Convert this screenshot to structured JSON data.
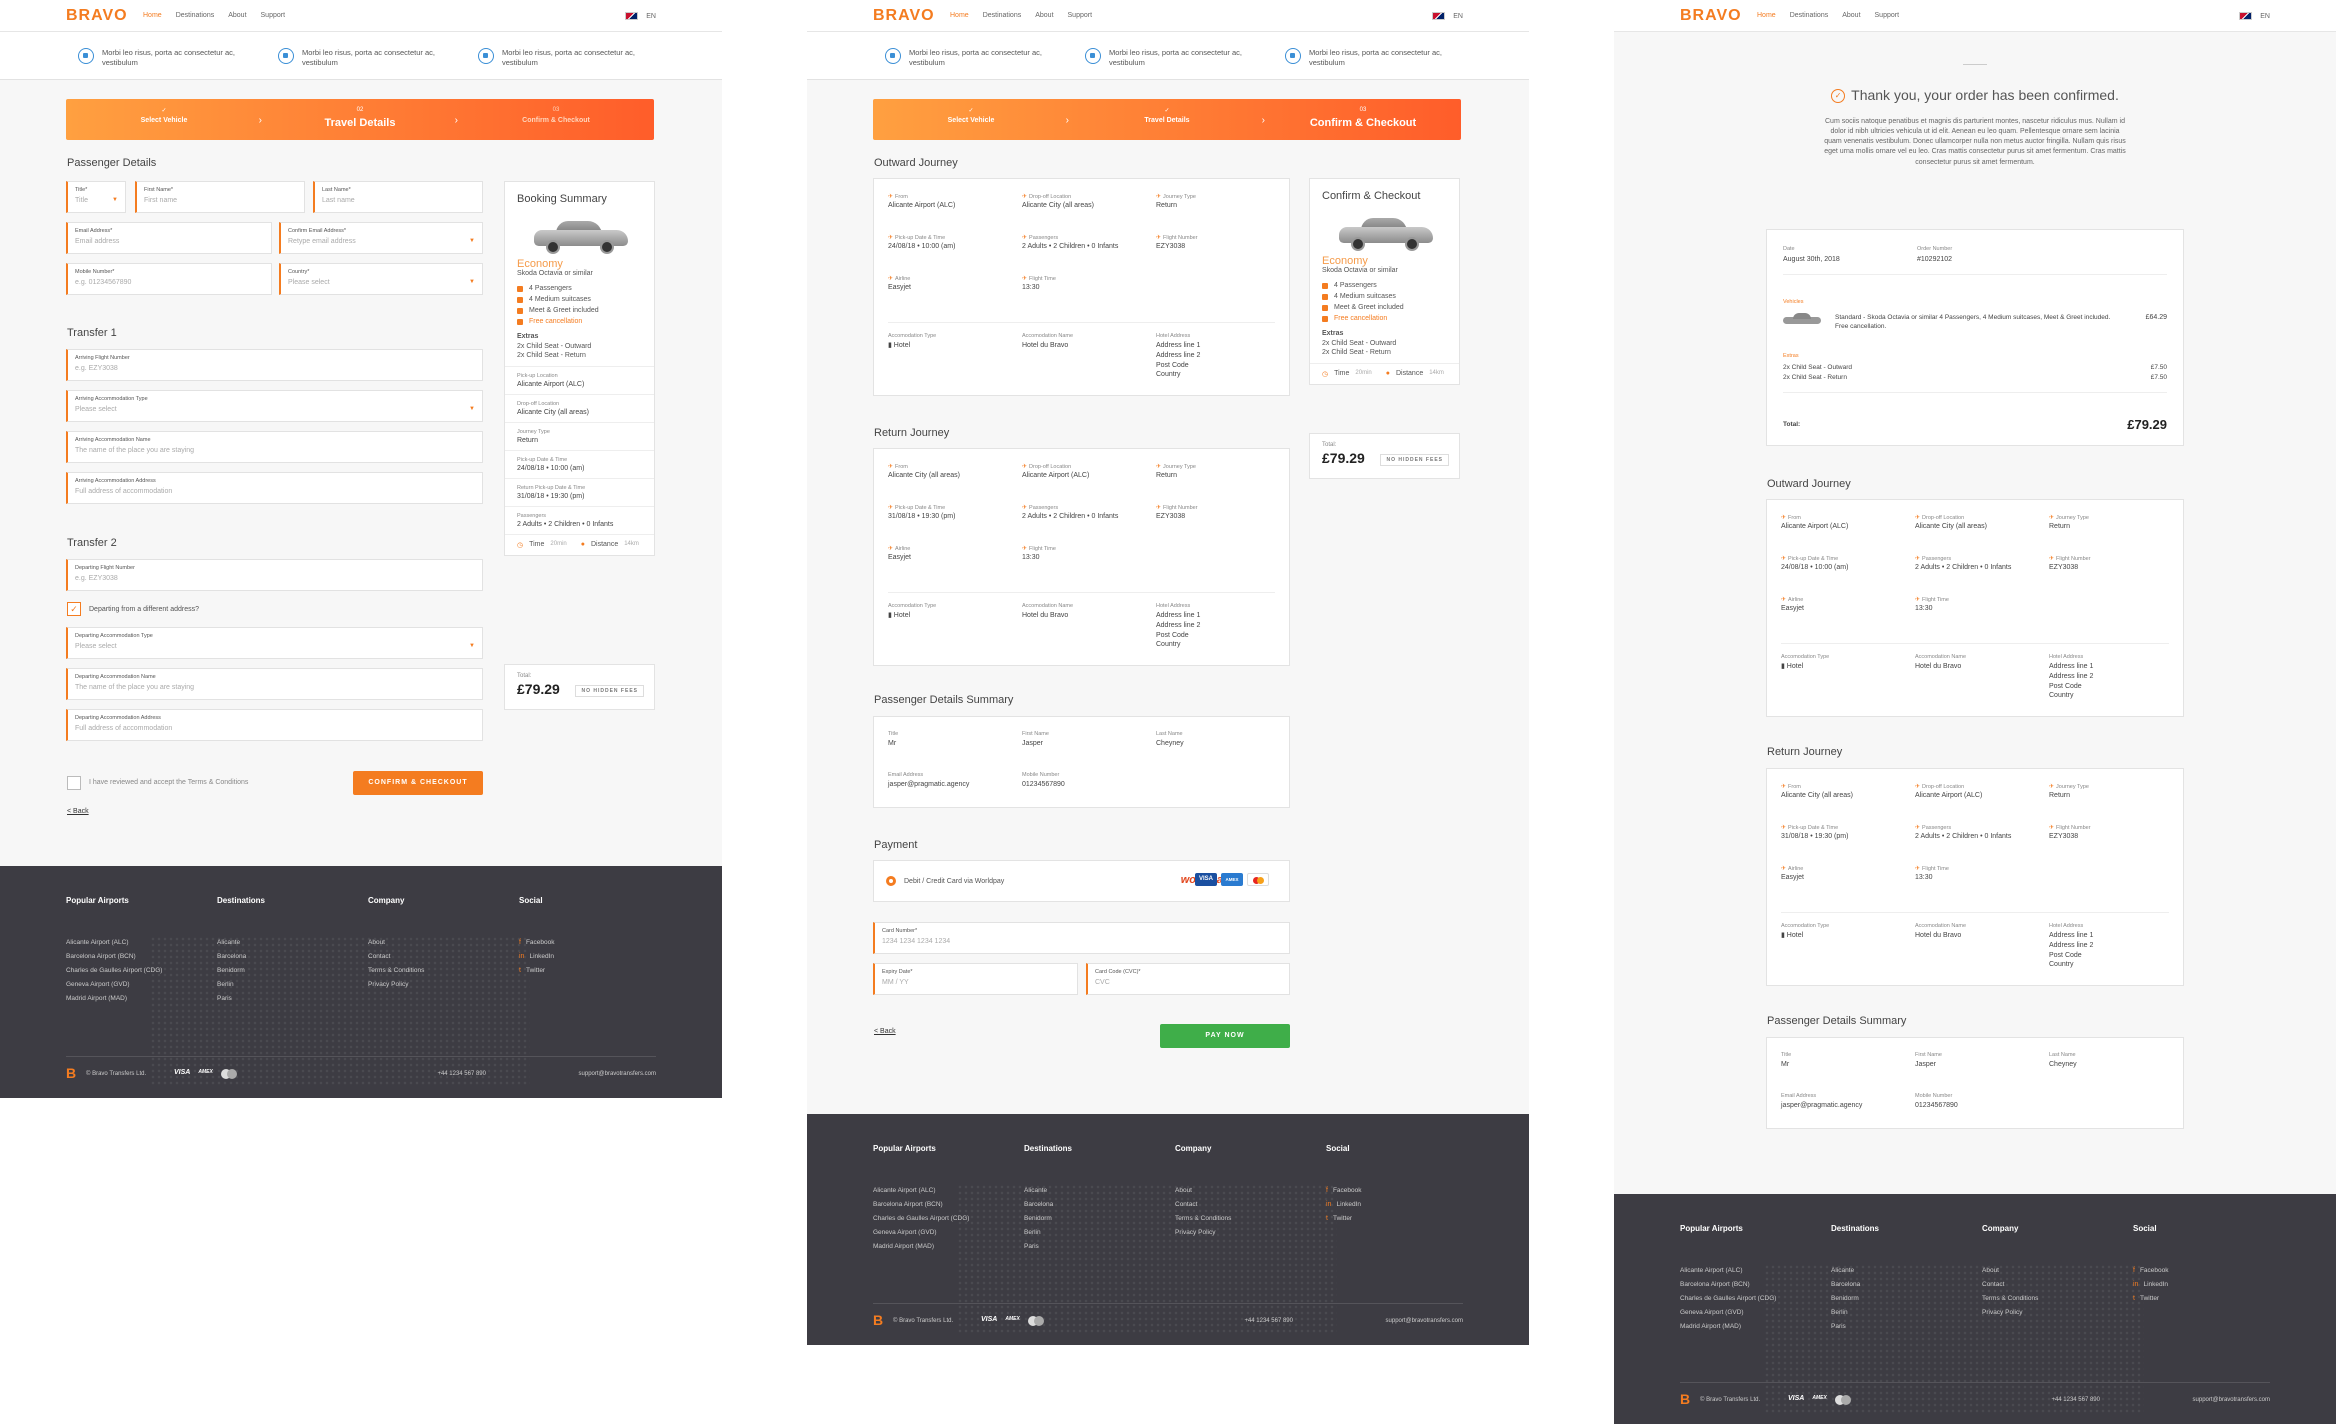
{
  "nav": {
    "logo": "BRAVO",
    "links": [
      "Home",
      "Destinations",
      "About",
      "Support"
    ],
    "lang": "EN"
  },
  "features": [
    "Morbi leo risus, porta ac consectetur ac, vestibulum",
    "Morbi leo risus, porta ac consectetur ac, vestibulum",
    "Morbi leo risus, porta ac consectetur ac, vestibulum"
  ],
  "steps": [
    {
      "n": "",
      "label": "Select Vehicle"
    },
    {
      "n": "02",
      "label": "Travel Details"
    },
    {
      "n": "03",
      "label": "Confirm & Checkout"
    }
  ],
  "steps2": [
    {
      "label": "Select Vehicle"
    },
    {
      "label": "Travel Details"
    },
    {
      "label": "Confirm & Checkout"
    }
  ],
  "check": "✓",
  "p1": {
    "passenger_title": "Passenger Details",
    "title": {
      "label": "Title*",
      "ph": "Title"
    },
    "first": {
      "label": "First Name*",
      "ph": "First name"
    },
    "last": {
      "label": "Last Name*",
      "ph": "Last name"
    },
    "email": {
      "label": "Email Address*",
      "ph": "Email address"
    },
    "email2": {
      "label": "Confirm Email Address*",
      "ph": "Retype email address"
    },
    "mobile": {
      "label": "Mobile Number*",
      "ph": "e.g. 01234567890"
    },
    "country": {
      "label": "Country*",
      "ph": "Please select"
    },
    "transfer1": "Transfer 1",
    "t1": [
      {
        "label": "Arriving Flight Number",
        "ph": "e.g. EZY3038"
      },
      {
        "label": "Arriving Accommodation Type",
        "ph": "Please select"
      },
      {
        "label": "Arriving Accommodation Name",
        "ph": "The name of the place you are staying"
      },
      {
        "label": "Arriving Accommodation Address",
        "ph": "Full address of accommodation"
      }
    ],
    "transfer2": "Transfer 2",
    "t2flight": {
      "label": "Departing Flight Number",
      "ph": "e.g. EZY3038"
    },
    "diff": "Departing from a different address?",
    "t2": [
      {
        "label": "Departing Accommodation Type",
        "ph": "Please select"
      },
      {
        "label": "Departing Accommodation Name",
        "ph": "The name of the place you are staying"
      },
      {
        "label": "Departing Accommodation Address",
        "ph": "Full address of accommodation"
      }
    ],
    "terms": "I have reviewed and accept the Terms & Conditions",
    "confirm_btn": "CONFIRM & CHECKOUT",
    "back": "< Back"
  },
  "summary": {
    "title1": "Booking Summary",
    "title2": "Confirm & Checkout",
    "class": "Economy",
    "car": "Skoda Octavia or similar",
    "features": [
      "4 Passengers",
      "4 Medium suitcases",
      "Meet & Greet included",
      "Free cancellation"
    ],
    "extras_label": "Extras",
    "extras": [
      "2x Child Seat - Outward",
      "2x Child Seat - Return"
    ],
    "details": [
      {
        "k": "Pick-up Location",
        "v": "Alicante Airport (ALC)"
      },
      {
        "k": "Drop-off Location",
        "v": "Alicante City (all areas)"
      },
      {
        "k": "Journey Type",
        "v": "Return"
      },
      {
        "k": "Pick-up Date & Time",
        "v": "24/08/18 • 10:00 (am)"
      },
      {
        "k": "Return Pick-up Date & Time",
        "v": "31/08/18 • 19:30 (pm)"
      },
      {
        "k": "Passengers",
        "v": "2 Adults • 2 Children • 0 Infants"
      }
    ],
    "time_label": "Time",
    "time": "20min",
    "dist_label": "Distance",
    "dist": "14km",
    "total_label": "Total:",
    "total": "£79.29",
    "nohidden": "NO HIDDEN FEES"
  },
  "outward": {
    "title": "Outward Journey",
    "from": "Alicante Airport (ALC)",
    "to": "Alicante City (all areas)",
    "type": "Return",
    "date": "24/08/18 • 10:00 (am)",
    "pax": "2 Adults • 2 Children • 0 Infants",
    "flight": "EZY3038",
    "airline": "Easyjet",
    "ftime": "13:30"
  },
  "return": {
    "title": "Return Journey",
    "from": "Alicante City (all areas)",
    "to": "Alicante Airport (ALC)",
    "type": "Return",
    "date": "31/08/18 • 19:30 (pm)",
    "pax": "2 Adults • 2 Children • 0 Infants",
    "flight": "EZY3038",
    "airline": "Easyjet",
    "ftime": "13:30"
  },
  "jlabels": {
    "from": "From",
    "to": "Drop-off Location",
    "type": "Journey Type",
    "date": "Pick-up Date & Time",
    "pax": "Passengers",
    "flight": "Flight Number",
    "airline": "Airline",
    "ftime": "Flight Time",
    "acc_type": "Accomodation Type",
    "acc_name": "Accomodation Name",
    "hotel_addr": "Hotel Address"
  },
  "accom": {
    "type": "Hotel",
    "name": "Hotel du Bravo",
    "addr": "Address line 1\nAddress line 2\nPost Code\nCountry"
  },
  "pax_summary": {
    "title": "Passenger Details Summary",
    "title_k": "Title",
    "title_v": "Mr",
    "first_k": "First Name",
    "first_v": "Jasper",
    "last_k": "Last Name",
    "last_v": "Cheyney",
    "email_k": "Email Address",
    "email_v": "jasper@pragmatic.agency",
    "mobile_k": "Mobile Number",
    "mobile_v": "01234567890"
  },
  "payment": {
    "title": "Payment",
    "method": "Debit / Credit Card via Worldpay",
    "worldpay": "worldpay",
    "visa": "VISA",
    "amex": "AMEX",
    "card": {
      "label": "Card Number*",
      "ph": "1234 1234 1234 1234"
    },
    "expiry": {
      "label": "Expiry Date*",
      "ph": "MM / YY"
    },
    "cvc": {
      "label": "Card Code (CVC)*",
      "ph": "CVC"
    },
    "back": "< Back",
    "pay_btn": "PAY NOW"
  },
  "confirmation": {
    "title": "Thank you, your order has been confirmed.",
    "text": "Cum sociis natoque penatibus et magnis dis parturient montes, nascetur ridiculus mus. Nullam id dolor id nibh ultricies vehicula ut id elit. Aenean eu leo quam. Pellentesque ornare sem lacinia quam venenatis vestibulum. Donec ullamcorper nulla non metus auctor fringilla. Nullam quis risus eget urna mollis ornare vel eu leo. Cras mattis consectetur purus sit amet fermentum. Cras mattis consectetur purus sit amet fermentum.",
    "date_k": "Date",
    "date_v": "August 30th, 2018",
    "order_k": "Order Number",
    "order_v": "#10292102",
    "vehicles": "Vehicles",
    "vehicle_desc": "Standard - Skoda Octavia or similar 4 Passengers, 4 Medium suitcases, Meet & Greet included. Free cancellation.",
    "vehicle_price": "£64.29",
    "extras": "Extras",
    "extra1": "2x Child Seat - Outward",
    "extra1_p": "£7.50",
    "extra2": "2x Child Seat - Return",
    "extra2_p": "£7.50",
    "total_k": "Total:",
    "total_v": "£79.29"
  },
  "footer": {
    "cols": [
      {
        "h": "Popular Airports",
        "items": [
          "Alicante Airport (ALC)",
          "Barcelona Airport (BCN)",
          "Charles de Gaulles Airport (CDG)",
          "Geneva Airport (GVD)",
          "Madrid Airport (MAD)"
        ]
      },
      {
        "h": "Destinations",
        "items": [
          "Alicante",
          "Barcelona",
          "Benidorm",
          "Berlin",
          "Paris"
        ]
      },
      {
        "h": "Company",
        "items": [
          "About",
          "Contact",
          "Terms & Conditions",
          "Privacy Policy"
        ]
      },
      {
        "h": "Social",
        "items": [
          "Facebook",
          "LinkedIn",
          "Twitter"
        ]
      }
    ],
    "logo": "B",
    "copy": "© Bravo Transfers Ltd.",
    "visa": "VISA",
    "amex": "AMEX",
    "phone": "+44 1234 567 890",
    "email": "support@bravotransfers.com"
  },
  "colors": {
    "accent": "#f47c20",
    "green": "#3fae49",
    "footer": "#3d3c43"
  }
}
